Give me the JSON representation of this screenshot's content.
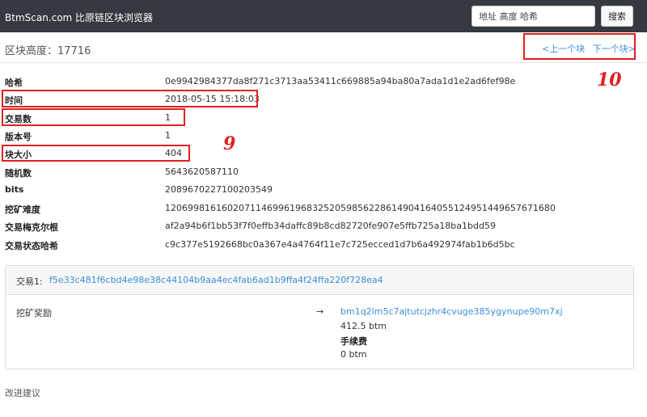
{
  "navbar": {
    "brand": "BtmScan.com 比原链区块浏览器",
    "search_placeholder": "地址 高度 哈希",
    "search_button": "搜索"
  },
  "block": {
    "height_label": "区块高度：",
    "height_value": "17716",
    "prev_label": "<上一个块",
    "next_label": "下一个块>",
    "fields": [
      {
        "label": "哈希",
        "value": "0e9942984377da8f271c3713aa53411c669885a94ba80a7ada1d1e2ad6fef98e"
      },
      {
        "label": "时间",
        "value": "2018-05-15 15:18:03"
      },
      {
        "label": "交易数",
        "value": "1"
      },
      {
        "label": "版本号",
        "value": "1"
      },
      {
        "label": "块大小",
        "value": "404"
      },
      {
        "label": "随机数",
        "value": "5643620587110"
      },
      {
        "label": "bits",
        "value": "2089670227100203549"
      },
      {
        "label": "挖矿难度",
        "value": "120699816160207114699619683252059856228614904164055124951449657671680"
      },
      {
        "label": "交易梅克尔根",
        "value": "af2a94b6f1bb53f7f0effb34daffc89b8cd82720fe907e5ffb725a18ba1bdd59"
      },
      {
        "label": "交易状态哈希",
        "value": "c9c377e5192668bc0a367e4a4764f11e7c725ecced1d7b6a492974fab1b6d5bc"
      }
    ]
  },
  "transaction": {
    "label": "交易1:",
    "hash": "f5e33c481f6cbd4e98e38c44104b9aa4ec4fab6ad1b9ffa4f24ffa220f728ea4",
    "input_label": "挖矿奖励",
    "arrow": "→",
    "output_address": "bm1q2lm5c7ajtutcjzhr4cvuge385ygynupe90m7xj",
    "output_amount": "412.5 btm",
    "fee_label": "手续费",
    "fee_amount": "0 btm"
  },
  "footer": {
    "suggest": "改进建议"
  },
  "annotations": {
    "num9": "9",
    "num10": "10",
    "color": "#e02020"
  }
}
